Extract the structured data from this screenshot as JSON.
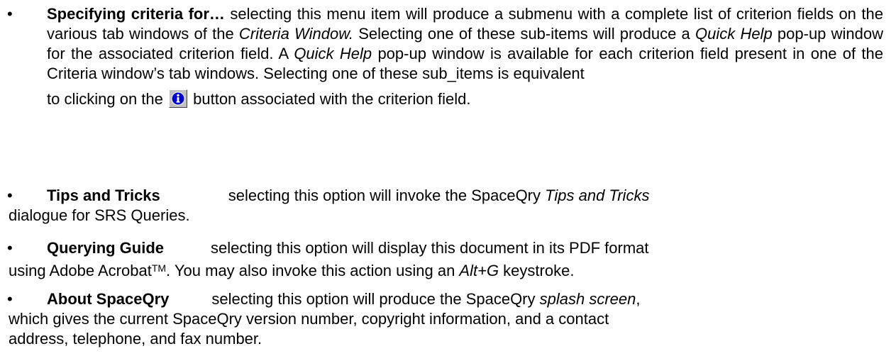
{
  "items": [
    {
      "term": "Specifying criteria for…",
      "seg1": " selecting this menu item will produce a submenu with a complete list of criterion fields on the various tab windows of the ",
      "italic1": "Criteria Window.",
      "seg2": " Selecting one of these sub-items will produce a ",
      "italic2": "Quick Help",
      "seg3": " pop-up window for the associated criterion field.  A ",
      "italic3": "Quick Help",
      "seg4": " pop-up window is available for each criterion field present in one of the Criteria window’s tab windows.  Selecting one of these sub_items is equivalent to clicking on the",
      "seg5": "button associated with the criterion field.",
      "icon": "info-icon"
    },
    {
      "term": "Tips and Tricks",
      "seg1": "selecting this option will invoke the SpaceQry ",
      "italic1": "Tips and Tricks",
      "seg2": " dialogue for SRS Queries."
    },
    {
      "term": "Querying Guide",
      "seg1": "selecting this option will display this document in its PDF format using Adobe Acrobat",
      "tm": "TM",
      "seg2": ".  You may also invoke this action using an  ",
      "italic1": "Alt+G",
      "seg3": " keystroke."
    },
    {
      "term": "About SpaceQry",
      "seg1": "selecting this option will produce the SpaceQry ",
      "italic1": "splash screen",
      "seg2": ", which gives the current SpaceQry version number, copyright information, and a contact address, telephone, and fax number."
    }
  ],
  "bullet": "•"
}
